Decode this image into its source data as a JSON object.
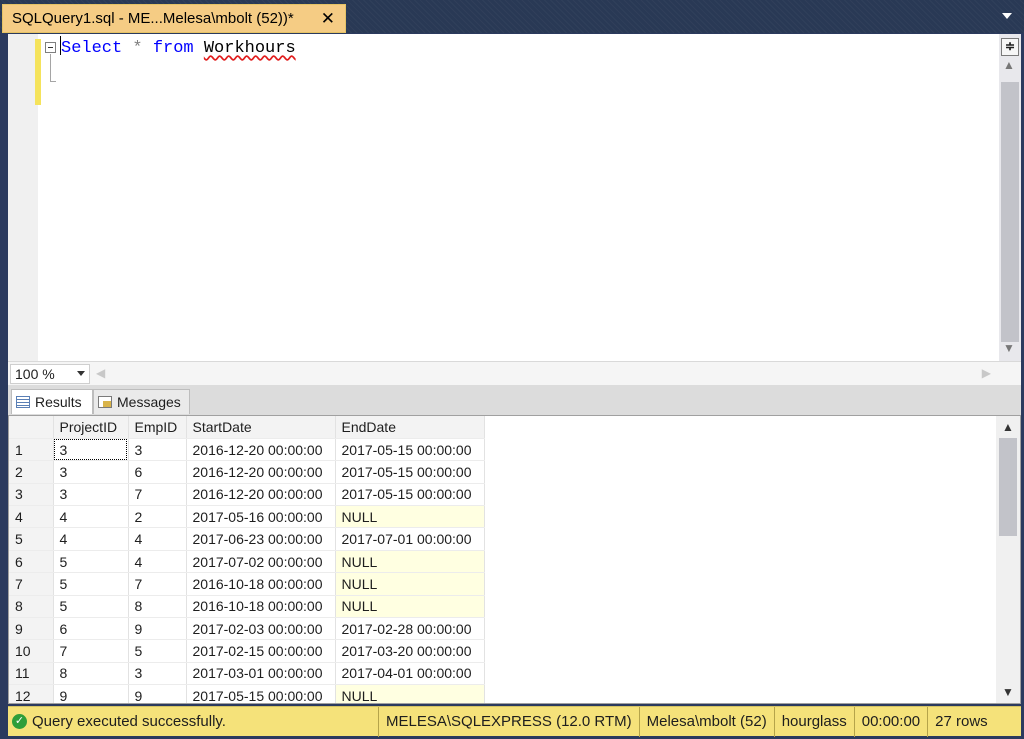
{
  "document_tab": {
    "title": "SQLQuery1.sql - ME...Melesa\\mbolt (52))*",
    "close_glyph": "✕"
  },
  "editor": {
    "query": {
      "keyword_select": "Select",
      "star": "*",
      "keyword_from": "from",
      "table": "Workhours"
    }
  },
  "zoom": {
    "value": "100 %"
  },
  "result_tabs": {
    "results": "Results",
    "messages": "Messages"
  },
  "grid": {
    "columns": [
      "ProjectID",
      "EmpID",
      "StartDate",
      "EndDate"
    ],
    "rows": [
      [
        "1",
        "3",
        "3",
        "2016-12-20 00:00:00",
        "2017-05-15 00:00:00"
      ],
      [
        "2",
        "3",
        "6",
        "2016-12-20 00:00:00",
        "2017-05-15 00:00:00"
      ],
      [
        "3",
        "3",
        "7",
        "2016-12-20 00:00:00",
        "2017-05-15 00:00:00"
      ],
      [
        "4",
        "4",
        "2",
        "2017-05-16 00:00:00",
        "NULL"
      ],
      [
        "5",
        "4",
        "4",
        "2017-06-23 00:00:00",
        "2017-07-01 00:00:00"
      ],
      [
        "6",
        "5",
        "4",
        "2017-07-02 00:00:00",
        "NULL"
      ],
      [
        "7",
        "5",
        "7",
        "2016-10-18 00:00:00",
        "NULL"
      ],
      [
        "8",
        "5",
        "8",
        "2016-10-18 00:00:00",
        "NULL"
      ],
      [
        "9",
        "6",
        "9",
        "2017-02-03 00:00:00",
        "2017-02-28 00:00:00"
      ],
      [
        "10",
        "7",
        "5",
        "2017-02-15 00:00:00",
        "2017-03-20 00:00:00"
      ],
      [
        "11",
        "8",
        "3",
        "2017-03-01 00:00:00",
        "2017-04-01 00:00:00"
      ],
      [
        "12",
        "9",
        "9",
        "2017-05-15 00:00:00",
        "NULL"
      ]
    ]
  },
  "status": {
    "message": "Query executed successfully.",
    "server": "MELESA\\SQLEXPRESS (12.0 RTM)",
    "user": "Melesa\\mbolt (52)",
    "database": "hourglass",
    "elapsed": "00:00:00",
    "rows": "27 rows"
  },
  "colors": {
    "tab_active": "#f5cc84",
    "status_bar": "#f5e27a",
    "null_cell": "#ffffe1",
    "keyword": "#0000ff"
  },
  "icons": {
    "close": "close-icon",
    "success": "success-check-icon",
    "results": "grid-icon",
    "messages": "messages-icon"
  }
}
